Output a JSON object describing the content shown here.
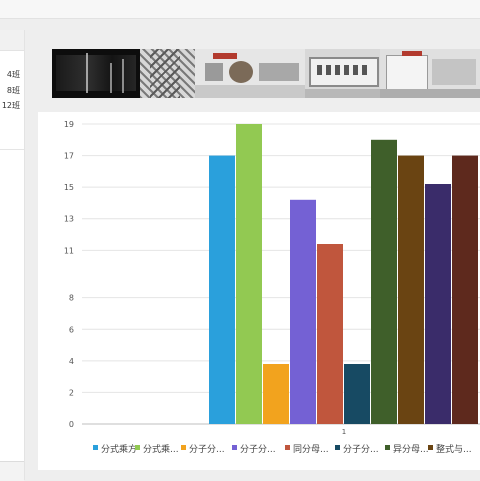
{
  "sidebar": {
    "classes": [
      "4班",
      "8班",
      "12班"
    ]
  },
  "chart_data": {
    "type": "bar",
    "categories": [
      "1"
    ],
    "ylim": [
      0,
      19
    ],
    "yticks": [
      0,
      2,
      4,
      6,
      8,
      11,
      13,
      15,
      17,
      19
    ],
    "grid": true,
    "legend_position": "bottom",
    "series": [
      {
        "name": "分式乘方",
        "values": [
          17
        ],
        "color": "#2aa0dc"
      },
      {
        "name": "分式乘...",
        "values": [
          19
        ],
        "color": "#92c952"
      },
      {
        "name": "分子分...",
        "values": [
          3.8
        ],
        "color": "#f2a31e"
      },
      {
        "name": "分子分...",
        "values": [
          14.2
        ],
        "color": "#7461d4"
      },
      {
        "name": "同分母...",
        "values": [
          11.4
        ],
        "color": "#c0563d"
      },
      {
        "name": "分子分...",
        "values": [
          3.8
        ],
        "color": "#174a63"
      },
      {
        "name": "异分母...",
        "values": [
          18
        ],
        "color": "#3f5f2a"
      },
      {
        "name": "整式与...",
        "values": [
          17
        ],
        "color": "#6a4412"
      },
      {
        "name": "",
        "values": [
          15.2
        ],
        "color": "#3a2c6a"
      },
      {
        "name": "",
        "values": [
          17
        ],
        "color": "#5e291d"
      }
    ]
  }
}
